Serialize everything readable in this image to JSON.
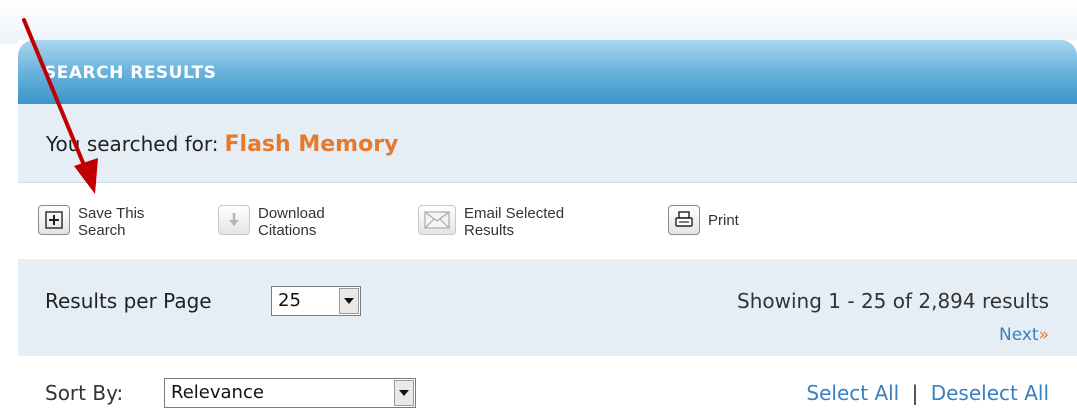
{
  "header": {
    "title": "SEARCH RESULTS"
  },
  "search": {
    "prefix": "You searched for:",
    "term": "Flash Memory"
  },
  "toolbar": {
    "save": [
      "Save This",
      "Search"
    ],
    "download": [
      "Download",
      "Citations"
    ],
    "email": [
      "Email Selected",
      "Results"
    ],
    "print": "Print"
  },
  "results": {
    "per_page_label": "Results per Page",
    "per_page_value": "25",
    "showing": "Showing 1 - 25 of 2,894 results",
    "next": "Next",
    "next_symbol": "»"
  },
  "sort": {
    "label": "Sort By:",
    "value": "Relevance",
    "select_all": "Select All",
    "separator": "|",
    "deselect_all": "Deselect All"
  },
  "colors": {
    "term": "#e8792b",
    "link": "#3a7fc0",
    "header": "#3b95c9",
    "annotation_arrow": "#c00000"
  }
}
